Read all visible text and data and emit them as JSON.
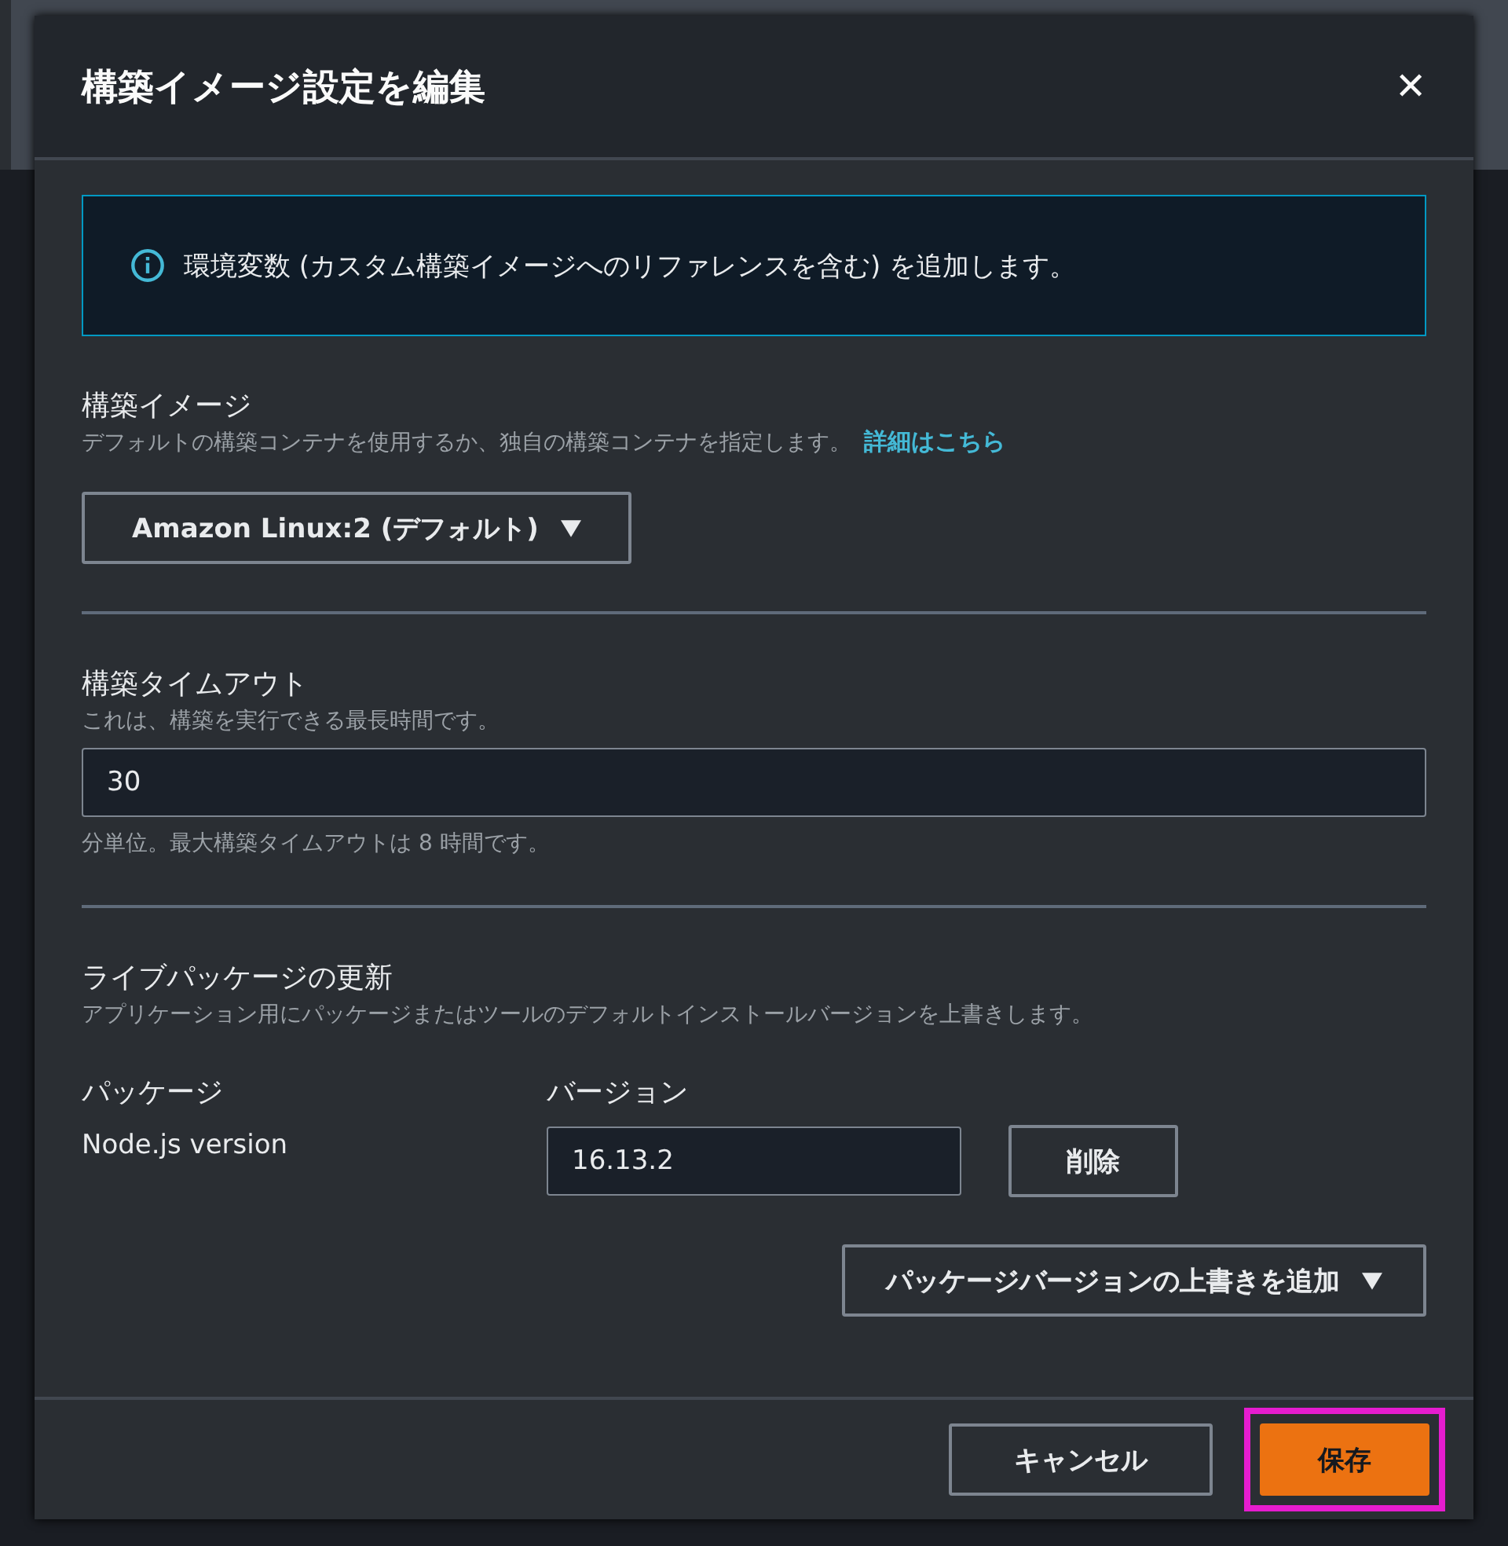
{
  "dialog": {
    "title": "構築イメージ設定を編集",
    "close": "✕"
  },
  "alert": {
    "text": "環境変数 (カスタム構築イメージへのリファレンスを含む) を追加します。"
  },
  "build_image": {
    "label": "構築イメージ",
    "description": "デフォルトの構築コンテナを使用するか、独自の構築コンテナを指定します。",
    "link": "詳細はこちら",
    "dropdown": "Amazon Linux:2 (デフォルト)"
  },
  "timeout": {
    "label": "構築タイムアウト",
    "description": "これは、構築を実行できる最長時間です。",
    "value": "30",
    "hint": "分単位。最大構築タイムアウトは 8 時間です。"
  },
  "live_packages": {
    "label": "ライブパッケージの更新",
    "description": "アプリケーション用にパッケージまたはツールのデフォルトインストールバージョンを上書きします。",
    "columns": [
      "パッケージ",
      "バージョン"
    ],
    "rows": [
      {
        "package": "Node.js version",
        "version": "16.13.2",
        "remove": "削除"
      }
    ],
    "add_button": "パッケージバージョンの上書きを追加"
  },
  "footer": {
    "buttons": [
      {
        "label": "キャンセル",
        "kind": "secondary",
        "highlighted": false
      },
      {
        "label": "保存",
        "kind": "primary",
        "highlighted": true
      }
    ]
  }
}
